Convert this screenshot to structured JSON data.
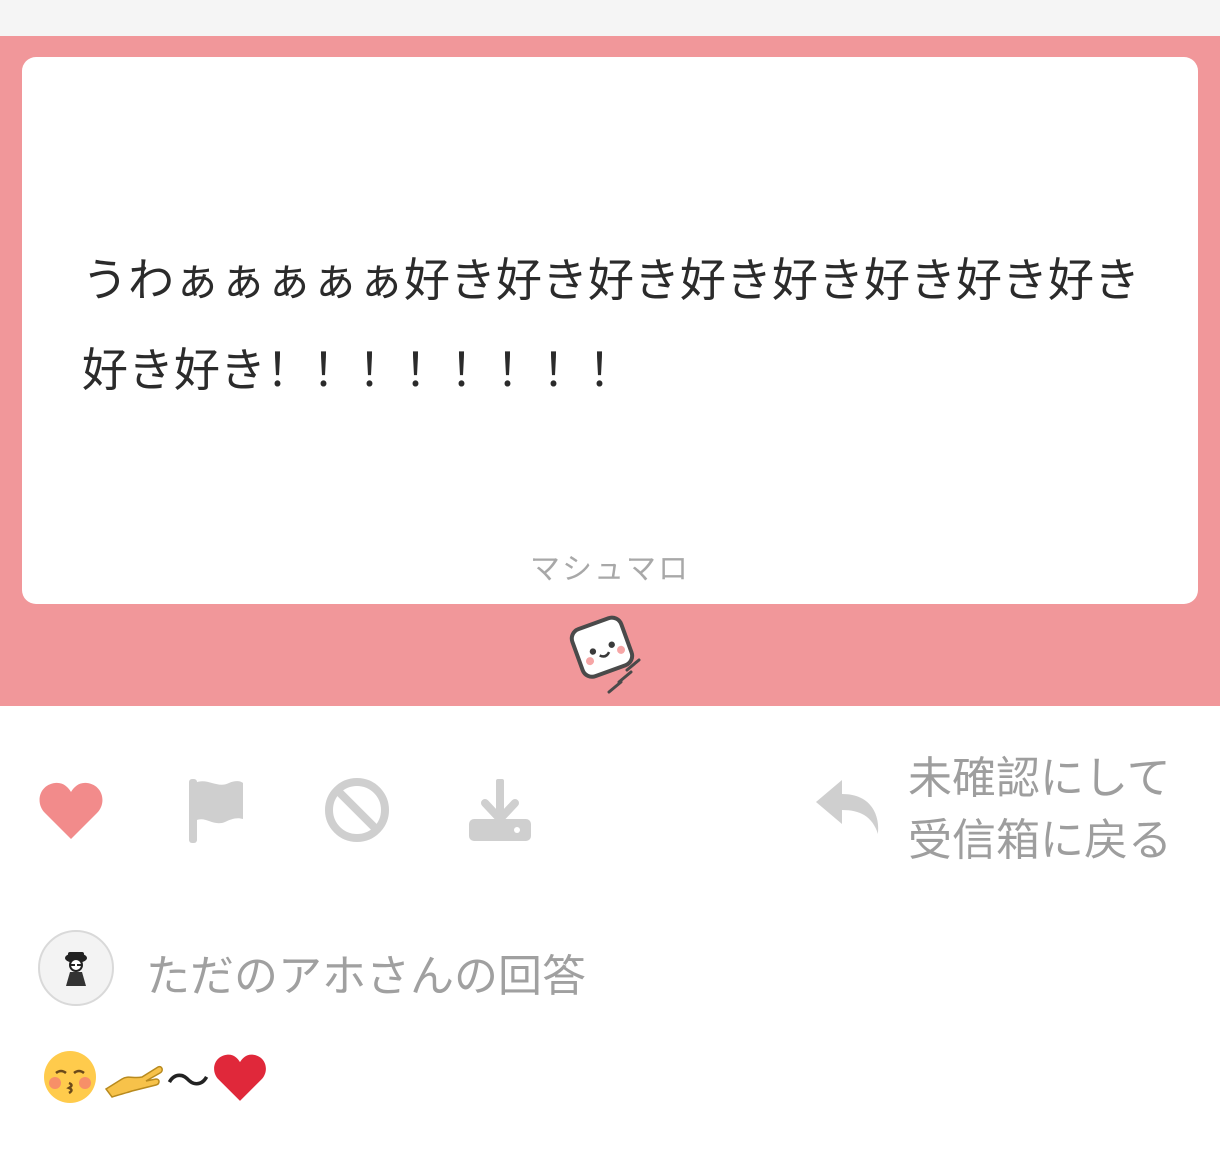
{
  "question": {
    "text": "うわぁぁぁぁぁ好き好き好き好き好き好き好き好き好き好き！！！！！！！！",
    "brand": "マシュマロ"
  },
  "actions": {
    "like_icon": "heart-icon",
    "report_icon": "flag-icon",
    "block_icon": "block-icon",
    "download_icon": "download-icon",
    "mark_unread_label": "未確認にして\n受信箱に戻る",
    "reply_icon": "undo-arrow-icon"
  },
  "answer": {
    "title": "ただのアホさんの回答",
    "body_tilde": "〜"
  },
  "colors": {
    "panel": "#f1979a",
    "heart": "#f28b8b",
    "icon_gray": "#cfcfcf",
    "text_gray": "#9e9e9e"
  }
}
